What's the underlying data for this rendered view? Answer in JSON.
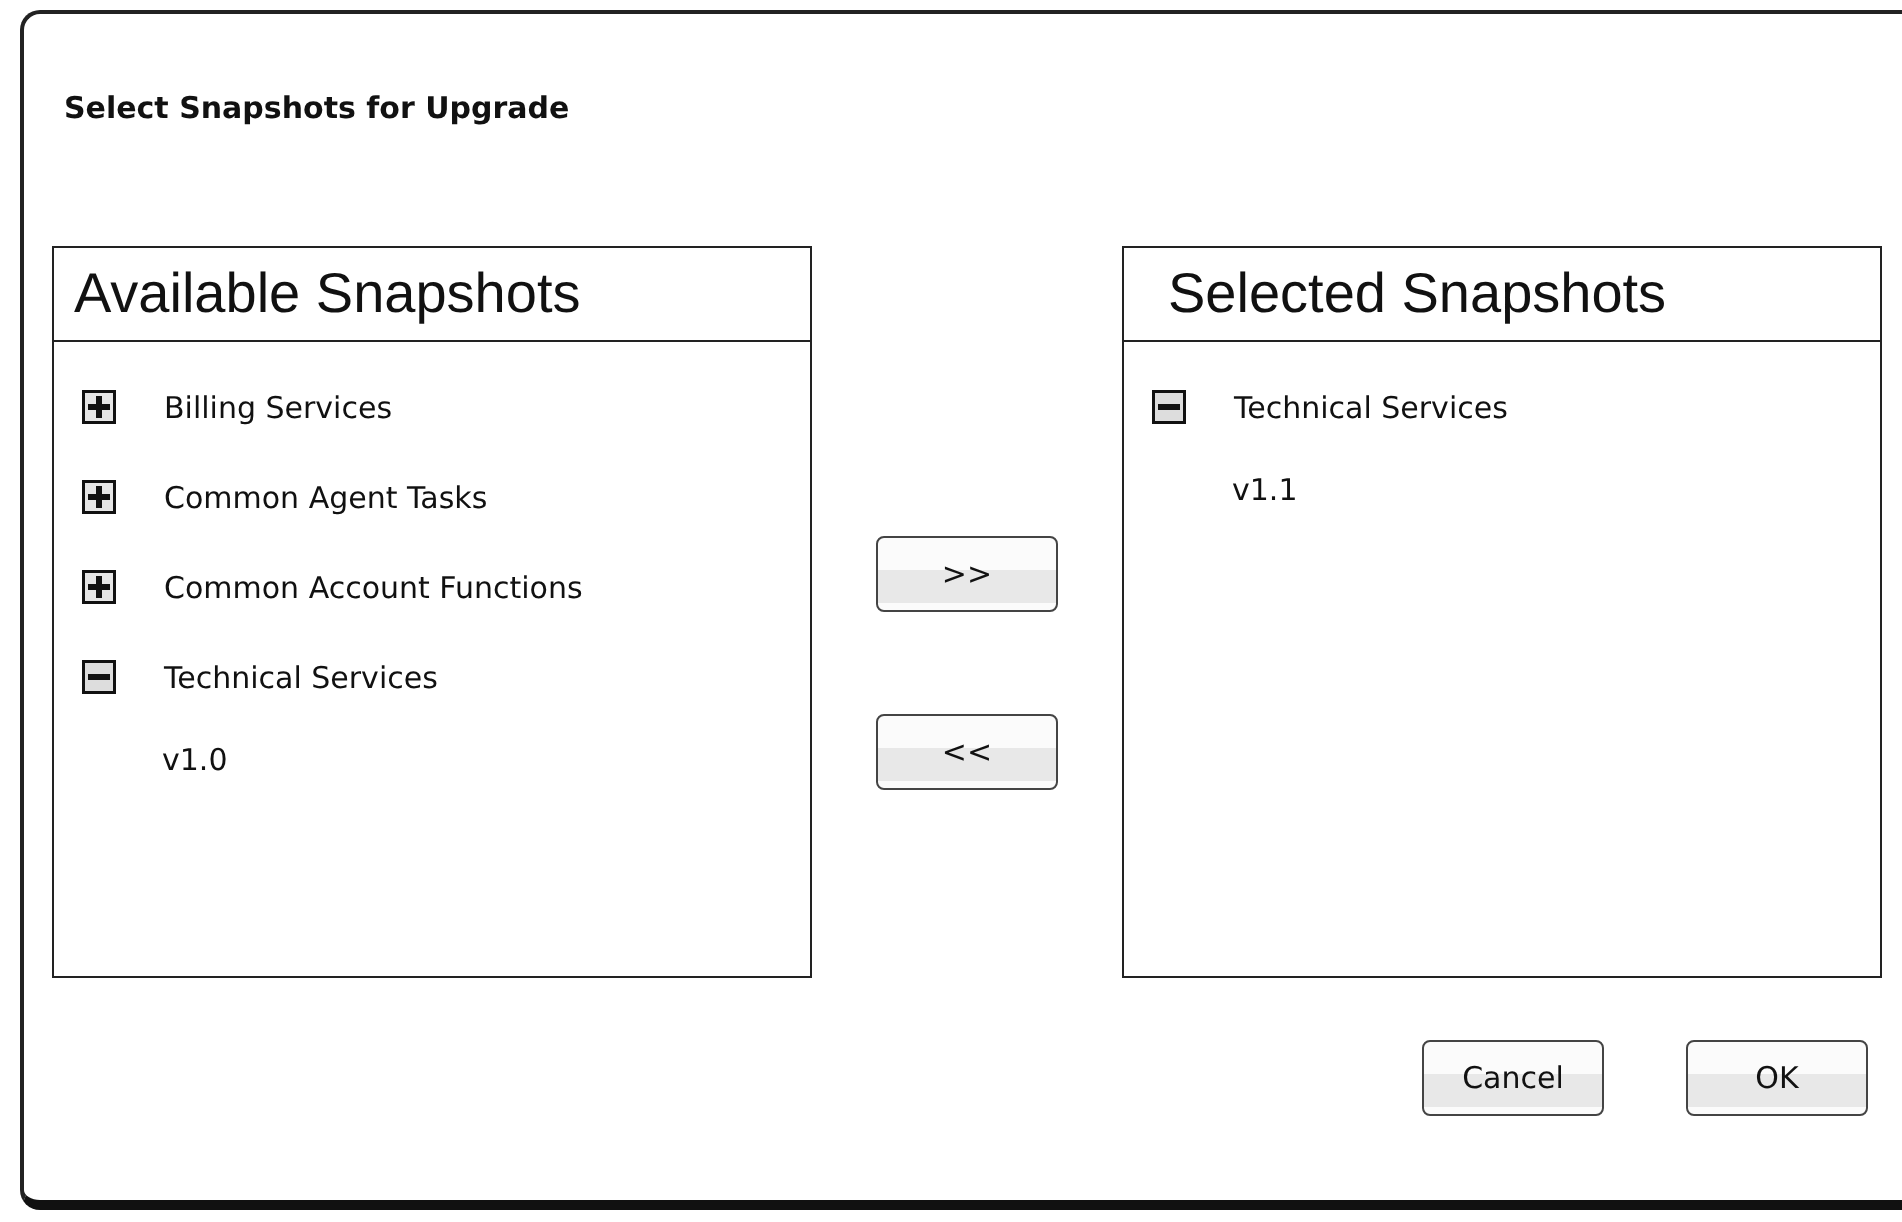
{
  "dialog": {
    "title": "Select Snapshots for Upgrade"
  },
  "available": {
    "title": "Available Snapshots",
    "items": [
      {
        "label": "Billing Services",
        "expanded": false
      },
      {
        "label": "Common Agent Tasks",
        "expanded": false
      },
      {
        "label": "Common Account Functions",
        "expanded": false
      },
      {
        "label": "Technical Services",
        "expanded": true,
        "children": [
          {
            "label": "v1.0"
          }
        ]
      }
    ]
  },
  "transfer_buttons": [
    ">>",
    "<<"
  ],
  "selected": {
    "title": "Selected Snapshots",
    "items": [
      {
        "label": "Technical Services",
        "expanded": true,
        "children": [
          {
            "label": "v1.1"
          }
        ]
      }
    ]
  },
  "buttons": [
    "Cancel",
    "OK"
  ]
}
